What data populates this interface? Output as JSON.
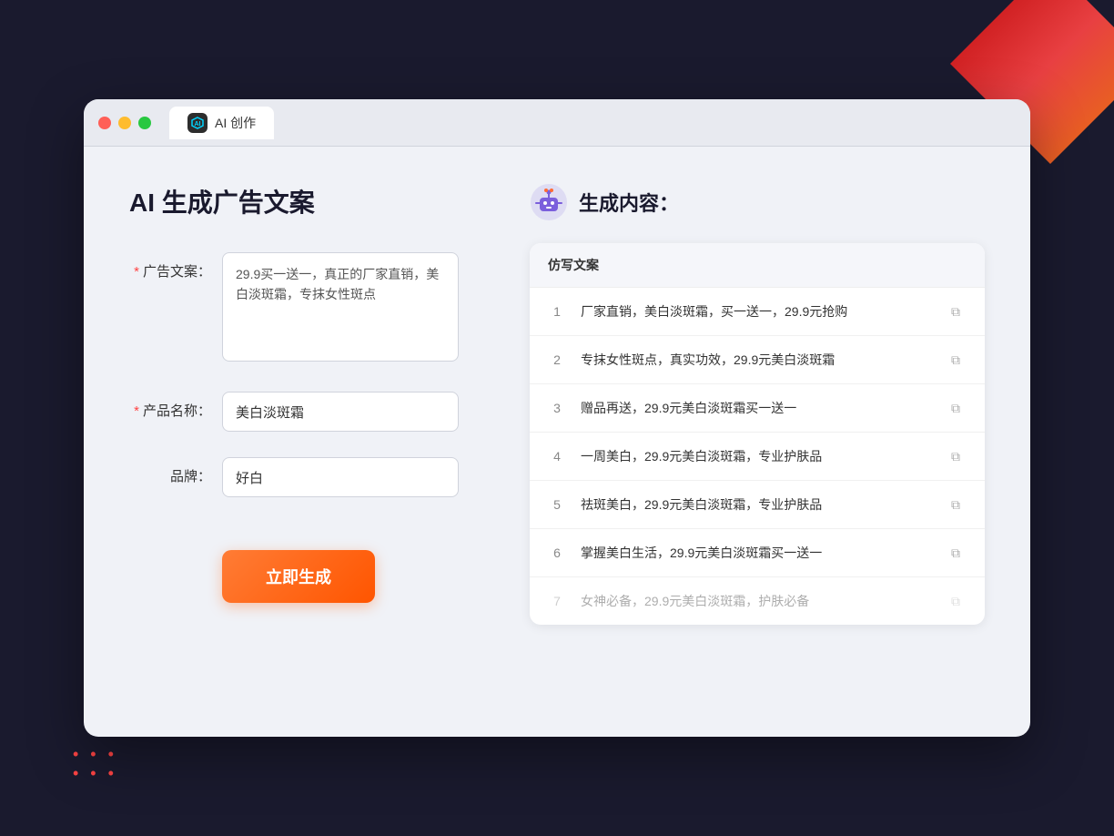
{
  "browser": {
    "tab_icon": "AI",
    "tab_label": "AI 创作"
  },
  "left": {
    "page_title": "AI 生成广告文案",
    "fields": [
      {
        "id": "ad_copy",
        "label": "广告文案：",
        "required": true,
        "type": "textarea",
        "value": "29.9买一送一，真正的厂家直销，美白淡斑霜，专抹女性斑点"
      },
      {
        "id": "product_name",
        "label": "产品名称：",
        "required": true,
        "type": "input",
        "value": "美白淡斑霜"
      },
      {
        "id": "brand",
        "label": "品牌：",
        "required": false,
        "type": "input",
        "value": "好白"
      }
    ],
    "submit_label": "立即生成"
  },
  "right": {
    "title": "生成内容：",
    "table_header": "仿写文案",
    "results": [
      {
        "num": "1",
        "text": "厂家直销，美白淡斑霜，买一送一，29.9元抢购",
        "dimmed": false
      },
      {
        "num": "2",
        "text": "专抹女性斑点，真实功效，29.9元美白淡斑霜",
        "dimmed": false
      },
      {
        "num": "3",
        "text": "赠品再送，29.9元美白淡斑霜买一送一",
        "dimmed": false
      },
      {
        "num": "4",
        "text": "一周美白，29.9元美白淡斑霜，专业护肤品",
        "dimmed": false
      },
      {
        "num": "5",
        "text": "祛斑美白，29.9元美白淡斑霜，专业护肤品",
        "dimmed": false
      },
      {
        "num": "6",
        "text": "掌握美白生活，29.9元美白淡斑霜买一送一",
        "dimmed": false
      },
      {
        "num": "7",
        "text": "女神必备，29.9元美白淡斑霜，护肤必备",
        "dimmed": true
      }
    ]
  }
}
